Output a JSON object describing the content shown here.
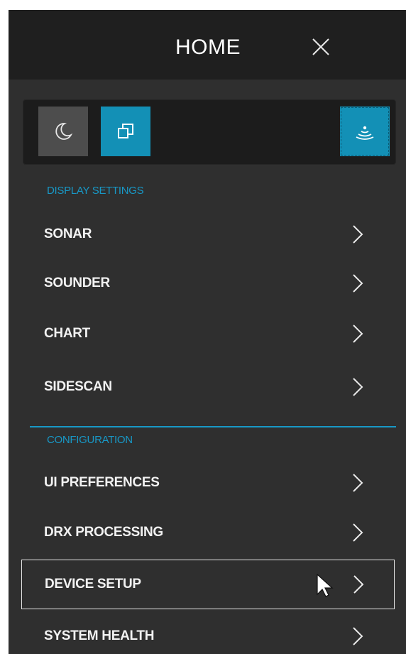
{
  "header": {
    "title": "HOME",
    "close_icon": "close-icon"
  },
  "toolbar": {
    "buttons": [
      {
        "name": "night-mode",
        "icon": "moon-icon",
        "active": false
      },
      {
        "name": "windows",
        "icon": "windows-icon",
        "active": true
      },
      {
        "name": "sonar",
        "icon": "sonar-icon",
        "active": true
      }
    ]
  },
  "display_settings": {
    "label": "DISPLAY SETTINGS",
    "items": [
      "SONAR",
      "SOUNDER",
      "CHART",
      "SIDESCAN"
    ]
  },
  "configuration": {
    "label": "CONFIGURATION",
    "items": [
      "UI PREFERENCES",
      "DRX PROCESSING",
      "DEVICE SETUP",
      "SYSTEM HEALTH"
    ],
    "selected": "DEVICE SETUP"
  },
  "colors": {
    "accent": "#1390b6",
    "section_label": "#1898c6",
    "panel": "#2f2f2f",
    "header": "#1f1f1f"
  }
}
